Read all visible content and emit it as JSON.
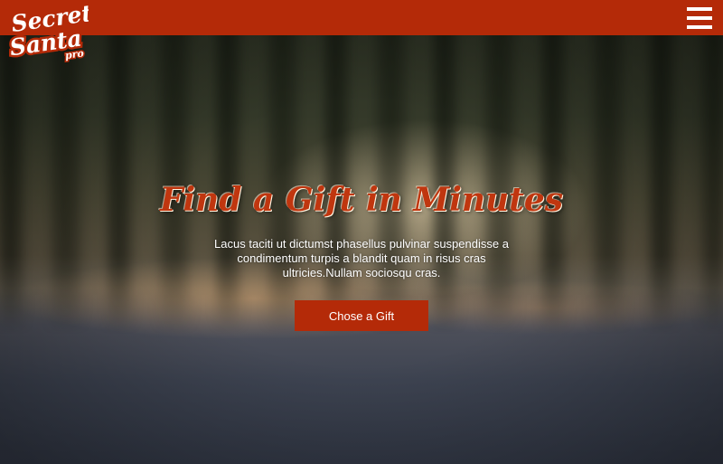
{
  "brand": {
    "logo_line1": "Secret",
    "logo_line2": "Santa",
    "logo_suffix": "pro",
    "accent_color": "#b42a08"
  },
  "header": {
    "menu_icon": "hamburger-menu-icon"
  },
  "hero": {
    "title": "Find a Gift in Minutes",
    "description": "Lacus taciti ut dictumst phasellus pulvinar suspendisse a condimentum turpis a blandit quam in risus cras ultricies.Nullam sociosqu cras.",
    "cta_label": "Chose a Gift"
  }
}
